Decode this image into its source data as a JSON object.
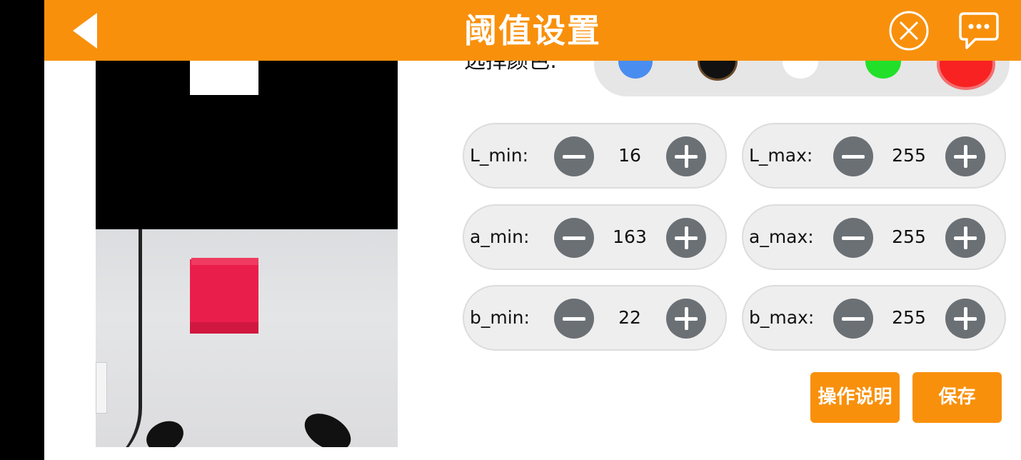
{
  "header": {
    "title": "阈值设置",
    "accent_color": "#F8900C",
    "icons": [
      "back-arrow-icon",
      "close-circle-icon",
      "chat-bubble-icon"
    ]
  },
  "color_select": {
    "label": "选择颜色:",
    "options": [
      {
        "name": "blue",
        "color": "#4a8df0"
      },
      {
        "name": "black",
        "color": "#111111"
      },
      {
        "name": "white",
        "color": "#ffffff"
      },
      {
        "name": "green",
        "color": "#22e02a"
      },
      {
        "name": "red",
        "color": "#f82222",
        "selected": true
      }
    ]
  },
  "thresholds": [
    {
      "label": "L_min:",
      "value": "16"
    },
    {
      "label": "L_max:",
      "value": "255"
    },
    {
      "label": "a_min:",
      "value": "163"
    },
    {
      "label": "a_max:",
      "value": "255"
    },
    {
      "label": "b_min:",
      "value": "22"
    },
    {
      "label": "b_max:",
      "value": "255"
    }
  ],
  "buttons": {
    "help": "操作说明",
    "save": "保存"
  }
}
